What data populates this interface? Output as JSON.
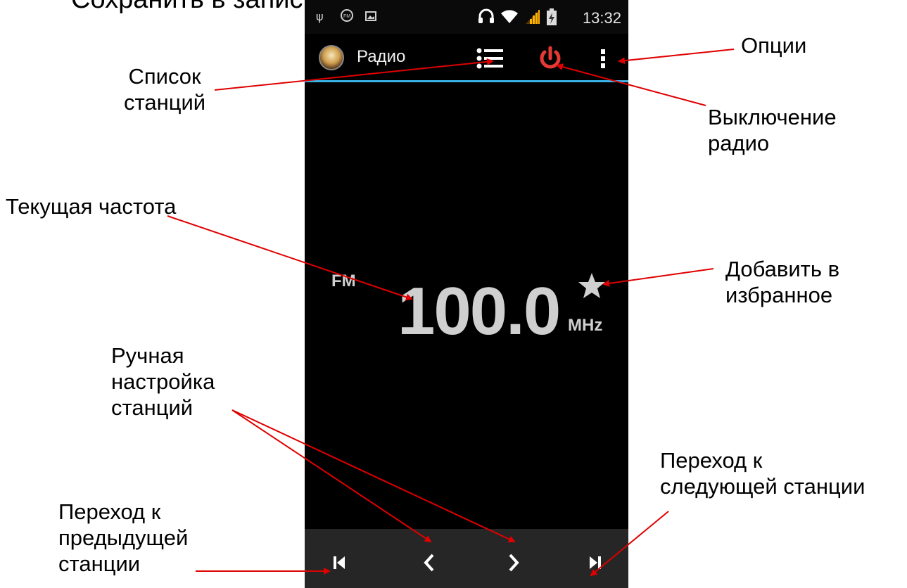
{
  "slide_title": "Сохранить в записи в файл.",
  "status_bar": {
    "time": "13:32"
  },
  "app": {
    "title": "Радио"
  },
  "tuner": {
    "band": "FM",
    "frequency": "100.0",
    "unit": "MHz"
  },
  "callouts": {
    "station_list": [
      "Список",
      "станций"
    ],
    "options": [
      "Опции"
    ],
    "power_off": [
      "Выключение",
      "радио"
    ],
    "current_freq": [
      "Текущая частота"
    ],
    "add_favorite": [
      "Добавить в",
      "избранное"
    ],
    "manual_tune": [
      "Ручная",
      "настройка",
      "станций"
    ],
    "next_station": [
      "Переход к",
      "следующей станции"
    ],
    "prev_station": [
      "Переход к",
      "предыдущей",
      "станции"
    ]
  },
  "colors": {
    "accent_blue": "#39b2e5",
    "power_red": "#e53935",
    "arrow_red": "#e00000"
  },
  "icons": [
    "usb-icon",
    "fm-icon",
    "image-icon",
    "headphones-icon",
    "wifi-icon",
    "signal-icon",
    "battery-icon",
    "station-list-icon",
    "power-icon",
    "overflow-menu-icon",
    "star-icon",
    "prev-station-icon",
    "tune-down-icon",
    "tune-up-icon",
    "next-station-icon"
  ]
}
